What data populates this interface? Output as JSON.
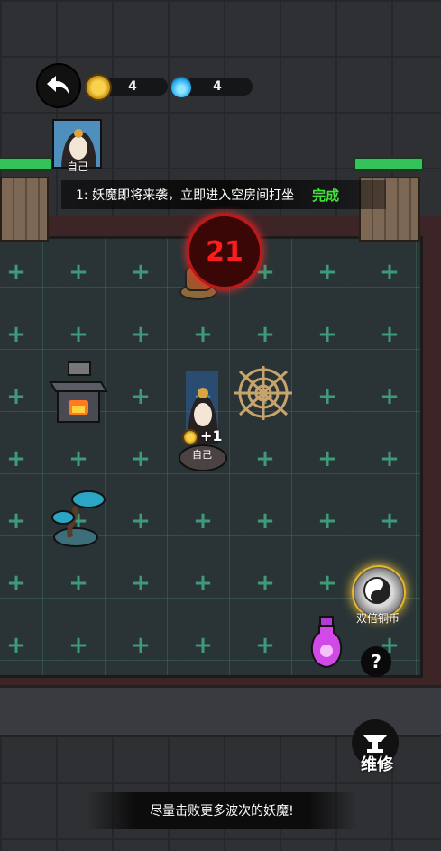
{
  "hud": {
    "coin_count": "4",
    "soul_count": "4",
    "back_icon": "back-arrow-icon"
  },
  "player": {
    "avatar_label": "自己",
    "field_label": "自己",
    "gain_text": "+1"
  },
  "quest": {
    "text": "1:  妖魔即将来袭，立即进入空房间打坐",
    "status": "完成"
  },
  "wave_timer": "21",
  "items": {
    "double_coin_label": "双倍铜币",
    "help_label": "?",
    "repair_label": "维修"
  },
  "bottom_tip": "尽量击败更多波次的妖魔!",
  "colors": {
    "accent_green": "#42e13c",
    "timer_red": "#ff1c1c",
    "hp_green": "#34c35a"
  }
}
